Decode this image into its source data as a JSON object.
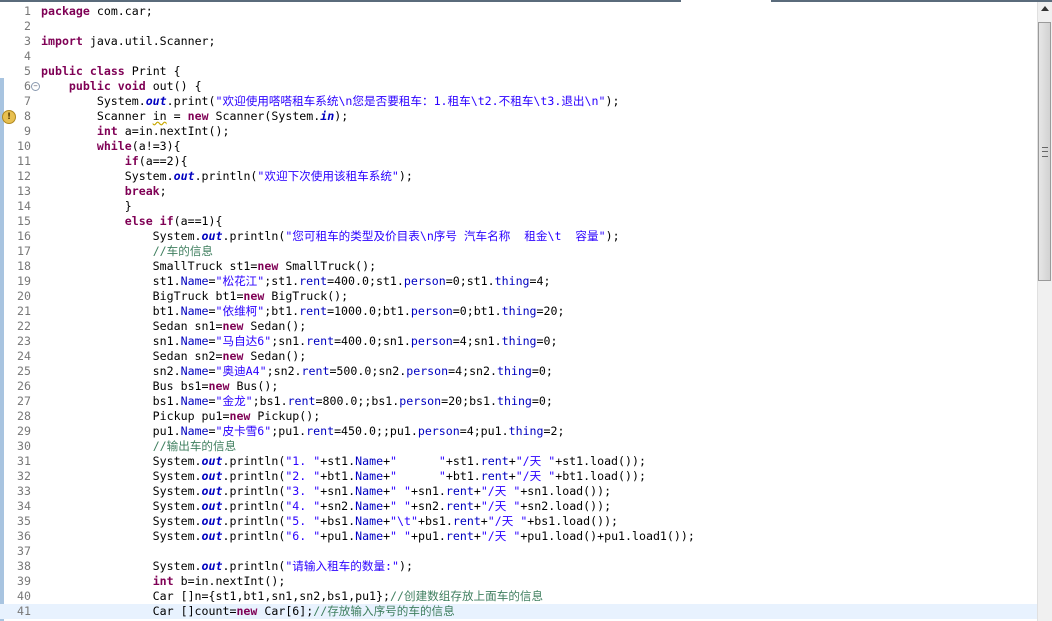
{
  "editor": {
    "current_line": 41,
    "lines": [
      [
        [
          "k",
          "package"
        ],
        [
          "p",
          " com.car;"
        ]
      ],
      [],
      [
        [
          "k",
          "import"
        ],
        [
          "p",
          " java.util.Scanner;"
        ]
      ],
      [],
      [
        [
          "k",
          "public"
        ],
        [
          "p",
          " "
        ],
        [
          "k",
          "class"
        ],
        [
          "p",
          " Print {"
        ]
      ],
      [
        [
          "p",
          "    "
        ],
        [
          "k",
          "public"
        ],
        [
          "p",
          " "
        ],
        [
          "k",
          "void"
        ],
        [
          "p",
          " out() {"
        ]
      ],
      [
        [
          "p",
          "        System."
        ],
        [
          "i",
          "out"
        ],
        [
          "p",
          ".print("
        ],
        [
          "s",
          "\"欢迎使用嗒嗒租车系统\\n您是否要租车：1.租车\\t2.不租车\\t3.退出\\n\""
        ],
        [
          "p",
          ");"
        ]
      ],
      [
        [
          "p",
          "        Scanner "
        ],
        [
          "w",
          "in"
        ],
        [
          "p",
          " = "
        ],
        [
          "k",
          "new"
        ],
        [
          "p",
          " Scanner(System."
        ],
        [
          "i",
          "in"
        ],
        [
          "p",
          ");"
        ]
      ],
      [
        [
          "p",
          "        "
        ],
        [
          "k",
          "int"
        ],
        [
          "p",
          " a=in.nextInt();"
        ]
      ],
      [
        [
          "p",
          "        "
        ],
        [
          "k",
          "while"
        ],
        [
          "p",
          "(a!=3){"
        ]
      ],
      [
        [
          "p",
          "            "
        ],
        [
          "k",
          "if"
        ],
        [
          "p",
          "(a==2){"
        ]
      ],
      [
        [
          "p",
          "            System."
        ],
        [
          "i",
          "out"
        ],
        [
          "p",
          ".println("
        ],
        [
          "s",
          "\"欢迎下次使用该租车系统\""
        ],
        [
          "p",
          ");"
        ]
      ],
      [
        [
          "p",
          "            "
        ],
        [
          "k",
          "break"
        ],
        [
          "p",
          ";"
        ]
      ],
      [
        [
          "p",
          "            }"
        ]
      ],
      [
        [
          "p",
          "            "
        ],
        [
          "k",
          "else"
        ],
        [
          "p",
          " "
        ],
        [
          "k",
          "if"
        ],
        [
          "p",
          "(a==1){"
        ]
      ],
      [
        [
          "p",
          "                System."
        ],
        [
          "i",
          "out"
        ],
        [
          "p",
          ".println("
        ],
        [
          "s",
          "\"您可租车的类型及价目表\\n序号 汽车名称  租金\\t  容量\""
        ],
        [
          "p",
          ");"
        ]
      ],
      [
        [
          "p",
          "                "
        ],
        [
          "c",
          "//车的信息"
        ]
      ],
      [
        [
          "p",
          "                SmallTruck st1="
        ],
        [
          "k",
          "new"
        ],
        [
          "p",
          " SmallTruck();"
        ]
      ],
      [
        [
          "p",
          "                st1."
        ],
        [
          "f",
          "Name"
        ],
        [
          "p",
          "="
        ],
        [
          "s",
          "\"松花江\""
        ],
        [
          "p",
          ";st1."
        ],
        [
          "f",
          "rent"
        ],
        [
          "p",
          "=400.0;st1."
        ],
        [
          "f",
          "person"
        ],
        [
          "p",
          "=0;st1."
        ],
        [
          "f",
          "thing"
        ],
        [
          "p",
          "=4;"
        ]
      ],
      [
        [
          "p",
          "                BigTruck bt1="
        ],
        [
          "k",
          "new"
        ],
        [
          "p",
          " BigTruck();"
        ]
      ],
      [
        [
          "p",
          "                bt1."
        ],
        [
          "f",
          "Name"
        ],
        [
          "p",
          "="
        ],
        [
          "s",
          "\"依维柯\""
        ],
        [
          "p",
          ";bt1."
        ],
        [
          "f",
          "rent"
        ],
        [
          "p",
          "=1000.0;bt1."
        ],
        [
          "f",
          "person"
        ],
        [
          "p",
          "=0;bt1."
        ],
        [
          "f",
          "thing"
        ],
        [
          "p",
          "=20;"
        ]
      ],
      [
        [
          "p",
          "                Sedan sn1="
        ],
        [
          "k",
          "new"
        ],
        [
          "p",
          " Sedan();"
        ]
      ],
      [
        [
          "p",
          "                sn1."
        ],
        [
          "f",
          "Name"
        ],
        [
          "p",
          "="
        ],
        [
          "s",
          "\"马自达6\""
        ],
        [
          "p",
          ";sn1."
        ],
        [
          "f",
          "rent"
        ],
        [
          "p",
          "=400.0;sn1."
        ],
        [
          "f",
          "person"
        ],
        [
          "p",
          "=4;sn1."
        ],
        [
          "f",
          "thing"
        ],
        [
          "p",
          "=0;"
        ]
      ],
      [
        [
          "p",
          "                Sedan sn2="
        ],
        [
          "k",
          "new"
        ],
        [
          "p",
          " Sedan();"
        ]
      ],
      [
        [
          "p",
          "                sn2."
        ],
        [
          "f",
          "Name"
        ],
        [
          "p",
          "="
        ],
        [
          "s",
          "\"奥迪A4\""
        ],
        [
          "p",
          ";sn2."
        ],
        [
          "f",
          "rent"
        ],
        [
          "p",
          "=500.0;sn2."
        ],
        [
          "f",
          "person"
        ],
        [
          "p",
          "=4;sn2."
        ],
        [
          "f",
          "thing"
        ],
        [
          "p",
          "=0;"
        ]
      ],
      [
        [
          "p",
          "                Bus bs1="
        ],
        [
          "k",
          "new"
        ],
        [
          "p",
          " Bus();"
        ]
      ],
      [
        [
          "p",
          "                bs1."
        ],
        [
          "f",
          "Name"
        ],
        [
          "p",
          "="
        ],
        [
          "s",
          "\"金龙\""
        ],
        [
          "p",
          ";bs1."
        ],
        [
          "f",
          "rent"
        ],
        [
          "p",
          "=800.0;;bs1."
        ],
        [
          "f",
          "person"
        ],
        [
          "p",
          "=20;bs1."
        ],
        [
          "f",
          "thing"
        ],
        [
          "p",
          "=0;"
        ]
      ],
      [
        [
          "p",
          "                Pickup pu1="
        ],
        [
          "k",
          "new"
        ],
        [
          "p",
          " Pickup();"
        ]
      ],
      [
        [
          "p",
          "                pu1."
        ],
        [
          "f",
          "Name"
        ],
        [
          "p",
          "="
        ],
        [
          "s",
          "\"皮卡雪6\""
        ],
        [
          "p",
          ";pu1."
        ],
        [
          "f",
          "rent"
        ],
        [
          "p",
          "=450.0;;pu1."
        ],
        [
          "f",
          "person"
        ],
        [
          "p",
          "=4;pu1."
        ],
        [
          "f",
          "thing"
        ],
        [
          "p",
          "=2;"
        ]
      ],
      [
        [
          "p",
          "                "
        ],
        [
          "c",
          "//输出车的信息"
        ]
      ],
      [
        [
          "p",
          "                System."
        ],
        [
          "i",
          "out"
        ],
        [
          "p",
          ".println("
        ],
        [
          "s",
          "\"1. \""
        ],
        [
          "p",
          "+st1."
        ],
        [
          "f",
          "Name"
        ],
        [
          "p",
          "+"
        ],
        [
          "s",
          "\"      \""
        ],
        [
          "p",
          "+st1."
        ],
        [
          "f",
          "rent"
        ],
        [
          "p",
          "+"
        ],
        [
          "s",
          "\"/天 \""
        ],
        [
          "p",
          "+st1.load());"
        ]
      ],
      [
        [
          "p",
          "                System."
        ],
        [
          "i",
          "out"
        ],
        [
          "p",
          ".println("
        ],
        [
          "s",
          "\"2. \""
        ],
        [
          "p",
          "+bt1."
        ],
        [
          "f",
          "Name"
        ],
        [
          "p",
          "+"
        ],
        [
          "s",
          "\"      \""
        ],
        [
          "p",
          "+bt1."
        ],
        [
          "f",
          "rent"
        ],
        [
          "p",
          "+"
        ],
        [
          "s",
          "\"/天 \""
        ],
        [
          "p",
          "+bt1.load());"
        ]
      ],
      [
        [
          "p",
          "                System."
        ],
        [
          "i",
          "out"
        ],
        [
          "p",
          ".println("
        ],
        [
          "s",
          "\"3. \""
        ],
        [
          "p",
          "+sn1."
        ],
        [
          "f",
          "Name"
        ],
        [
          "p",
          "+"
        ],
        [
          "s",
          "\" \""
        ],
        [
          "p",
          "+sn1."
        ],
        [
          "f",
          "rent"
        ],
        [
          "p",
          "+"
        ],
        [
          "s",
          "\"/天 \""
        ],
        [
          "p",
          "+sn1.load());"
        ]
      ],
      [
        [
          "p",
          "                System."
        ],
        [
          "i",
          "out"
        ],
        [
          "p",
          ".println("
        ],
        [
          "s",
          "\"4. \""
        ],
        [
          "p",
          "+sn2."
        ],
        [
          "f",
          "Name"
        ],
        [
          "p",
          "+"
        ],
        [
          "s",
          "\" \""
        ],
        [
          "p",
          "+sn2."
        ],
        [
          "f",
          "rent"
        ],
        [
          "p",
          "+"
        ],
        [
          "s",
          "\"/天 \""
        ],
        [
          "p",
          "+sn2.load());"
        ]
      ],
      [
        [
          "p",
          "                System."
        ],
        [
          "i",
          "out"
        ],
        [
          "p",
          ".println("
        ],
        [
          "s",
          "\"5. \""
        ],
        [
          "p",
          "+bs1."
        ],
        [
          "f",
          "Name"
        ],
        [
          "p",
          "+"
        ],
        [
          "s",
          "\"\\t\""
        ],
        [
          "p",
          "+bs1."
        ],
        [
          "f",
          "rent"
        ],
        [
          "p",
          "+"
        ],
        [
          "s",
          "\"/天 \""
        ],
        [
          "p",
          "+bs1.load());"
        ]
      ],
      [
        [
          "p",
          "                System."
        ],
        [
          "i",
          "out"
        ],
        [
          "p",
          ".println("
        ],
        [
          "s",
          "\"6. \""
        ],
        [
          "p",
          "+pu1."
        ],
        [
          "f",
          "Name"
        ],
        [
          "p",
          "+"
        ],
        [
          "s",
          "\" \""
        ],
        [
          "p",
          "+pu1."
        ],
        [
          "f",
          "rent"
        ],
        [
          "p",
          "+"
        ],
        [
          "s",
          "\"/天 \""
        ],
        [
          "p",
          "+pu1.load()+pu1.load1());"
        ]
      ],
      [],
      [
        [
          "p",
          "                System."
        ],
        [
          "i",
          "out"
        ],
        [
          "p",
          ".println("
        ],
        [
          "s",
          "\"请输入租车的数量:\""
        ],
        [
          "p",
          ");"
        ]
      ],
      [
        [
          "p",
          "                "
        ],
        [
          "k",
          "int"
        ],
        [
          "p",
          " b=in.nextInt();"
        ]
      ],
      [
        [
          "p",
          "                Car []n={st1,bt1,sn1,sn2,bs1,pu1};"
        ],
        [
          "c",
          "//创建数组存放上面车的信息"
        ]
      ],
      [
        [
          "p",
          "                Car []count="
        ],
        [
          "k",
          "new"
        ],
        [
          "p",
          " Car[6];"
        ],
        [
          "c",
          "//存放输入序号的车的信息"
        ]
      ]
    ],
    "markers": {
      "fold_line": 6,
      "warning_line": 8
    },
    "icons": {
      "fold": "collapse-icon",
      "warning": "warning-bulb-icon"
    }
  },
  "scrollbar": {
    "position_fraction": 0.0,
    "visible_fraction": 0.42
  }
}
